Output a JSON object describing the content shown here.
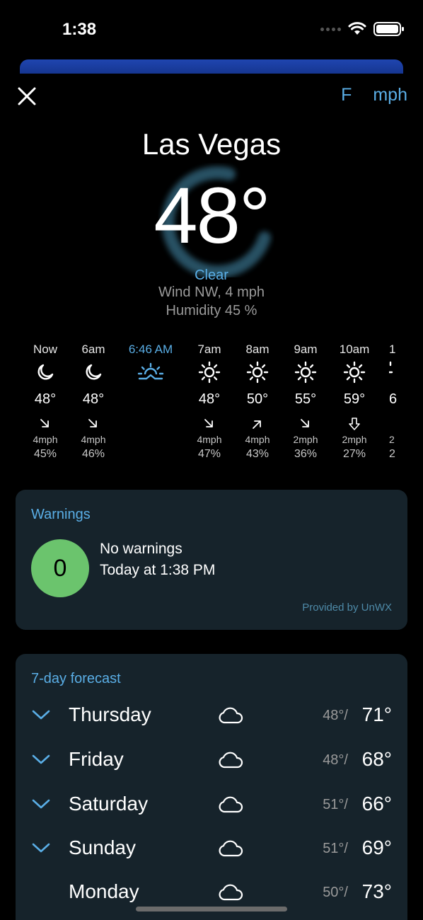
{
  "status": {
    "time": "1:38"
  },
  "units": {
    "temp": "F",
    "speed": "mph"
  },
  "current": {
    "city": "Las Vegas",
    "temperature": "48°",
    "condition": "Clear",
    "wind": "Wind NW, 4 mph",
    "humidity": "Humidity 45 %"
  },
  "hourly": [
    {
      "time": "Now",
      "icon": "moon-icon",
      "temp": "48°",
      "wind_dir": "arrow-down-right-icon",
      "wind": "4mph",
      "humidity": "45%"
    },
    {
      "time": "6am",
      "icon": "moon-icon",
      "temp": "48°",
      "wind_dir": "arrow-down-right-icon",
      "wind": "4mph",
      "humidity": "46%"
    },
    {
      "time": "6:46 AM",
      "icon": "sunrise-icon",
      "temp": "",
      "wind_dir": "",
      "wind": "",
      "humidity": ""
    },
    {
      "time": "7am",
      "icon": "sun-icon",
      "temp": "48°",
      "wind_dir": "arrow-down-right-icon",
      "wind": "4mph",
      "humidity": "47%"
    },
    {
      "time": "8am",
      "icon": "sun-icon",
      "temp": "50°",
      "wind_dir": "arrow-up-right-icon",
      "wind": "4mph",
      "humidity": "43%"
    },
    {
      "time": "9am",
      "icon": "sun-icon",
      "temp": "55°",
      "wind_dir": "arrow-down-right-icon",
      "wind": "2mph",
      "humidity": "36%"
    },
    {
      "time": "10am",
      "icon": "sun-icon",
      "temp": "59°",
      "wind_dir": "arrow-down-icon",
      "wind": "2mph",
      "humidity": "27%"
    },
    {
      "time": "1",
      "icon": "sun-icon",
      "temp": "6",
      "wind_dir": "",
      "wind": "2",
      "humidity": "2"
    }
  ],
  "warnings": {
    "title": "Warnings",
    "count": "0",
    "status": "No warnings",
    "updated": "Today at 1:38 PM",
    "provider": "Provided by UnWX",
    "badge_color": "#6bc46d"
  },
  "forecast": {
    "title": "7-day forecast",
    "days": [
      {
        "name": "Thursday",
        "icon": "cloud-icon",
        "low": "48°/",
        "high": "71°",
        "expandable": true
      },
      {
        "name": "Friday",
        "icon": "cloud-icon",
        "low": "48°/",
        "high": "68°",
        "expandable": true
      },
      {
        "name": "Saturday",
        "icon": "cloud-icon",
        "low": "51°/",
        "high": "66°",
        "expandable": true
      },
      {
        "name": "Sunday",
        "icon": "cloud-icon",
        "low": "51°/",
        "high": "69°",
        "expandable": true
      },
      {
        "name": "Monday",
        "icon": "cloud-icon",
        "low": "50°/",
        "high": "73°",
        "expandable": false
      }
    ]
  },
  "colors": {
    "accent": "#5aaee6",
    "card": "#16232b",
    "banner": "#1f45b0"
  }
}
